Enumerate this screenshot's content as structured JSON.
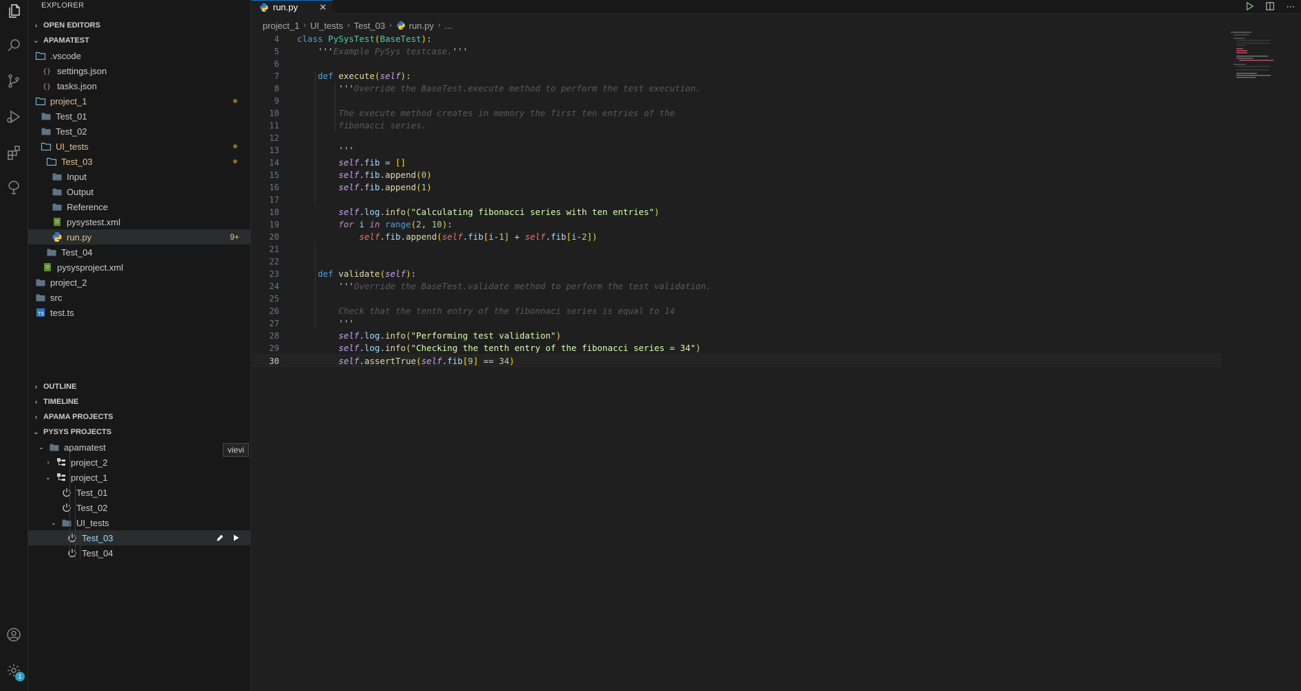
{
  "sidebar": {
    "title": "EXPLORER",
    "sections": {
      "open_editors": "OPEN EDITORS",
      "workspace": "APAMATEST",
      "outline": "OUTLINE",
      "timeline": "TIMELINE",
      "apama_projects": "APAMA PROJECTS",
      "pysys_projects": "PYSYS PROJECTS"
    },
    "files": [
      {
        "label": ".vscode",
        "icon": "folder-open-icon",
        "state": "normal"
      },
      {
        "label": "settings.json",
        "icon": "json-icon",
        "state": "normal"
      },
      {
        "label": "tasks.json",
        "icon": "json-icon",
        "state": "normal"
      },
      {
        "label": "project_1",
        "icon": "folder-open-icon",
        "state": "modified"
      },
      {
        "label": "Test_01",
        "icon": "folder-icon",
        "state": "normal"
      },
      {
        "label": "Test_02",
        "icon": "folder-icon",
        "state": "normal"
      },
      {
        "label": "UI_tests",
        "icon": "folder-open-icon",
        "state": "modified"
      },
      {
        "label": "Test_03",
        "icon": "folder-open-icon",
        "state": "modified"
      },
      {
        "label": "Input",
        "icon": "folder-icon",
        "state": "normal"
      },
      {
        "label": "Output",
        "icon": "folder-icon",
        "state": "normal"
      },
      {
        "label": "Reference",
        "icon": "folder-icon",
        "state": "normal"
      },
      {
        "label": "pysystest.xml",
        "icon": "xml-icon",
        "state": "normal"
      },
      {
        "label": "run.py",
        "icon": "python-icon",
        "state": "modified",
        "badge": "9+"
      },
      {
        "label": "Test_04",
        "icon": "folder-icon",
        "state": "normal"
      },
      {
        "label": "pysysproject.xml",
        "icon": "xml-icon",
        "state": "normal"
      },
      {
        "label": "project_2",
        "icon": "folder-icon",
        "state": "normal"
      },
      {
        "label": "src",
        "icon": "folder-icon",
        "state": "normal"
      },
      {
        "label": "test.ts",
        "icon": "typescript-icon",
        "state": "normal"
      }
    ],
    "pysys_tree": [
      {
        "label": "apamatest",
        "icon": "folder-icon"
      },
      {
        "label": "project_2",
        "icon": "project-icon"
      },
      {
        "label": "project_1",
        "icon": "project-icon"
      },
      {
        "label": "Test_01",
        "icon": "power-icon"
      },
      {
        "label": "Test_02",
        "icon": "power-icon"
      },
      {
        "label": "UI_tests",
        "icon": "folder-icon"
      },
      {
        "label": "Test_03",
        "icon": "power-icon"
      },
      {
        "label": "Test_04",
        "icon": "power-icon"
      }
    ],
    "hover_tooltip": "vievi"
  },
  "editor": {
    "tab_label": "run.py",
    "tab_close": "✕",
    "breadcrumb": [
      "project_1",
      "UI_tests",
      "Test_03",
      "run.py",
      "..."
    ]
  },
  "activity_badge": "1",
  "colors": {
    "modified": "#e2c08d",
    "accent": "#0078d4",
    "background": "#1f1f1f"
  }
}
